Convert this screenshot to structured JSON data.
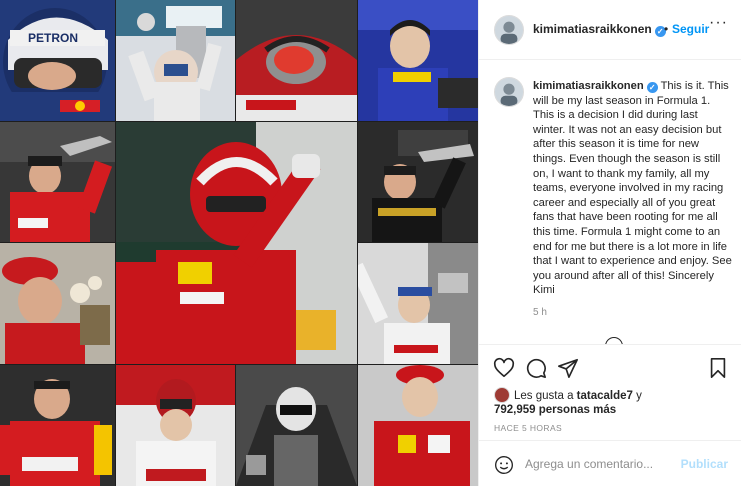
{
  "post": {
    "username": "kimimatiasraikkonen",
    "verified_glyph": "✓",
    "separator": "•",
    "follow_label": "Seguir",
    "more_glyph": "···",
    "caption": "This is it. This will be my last season in Formula 1. This is a decision I did during last winter. It was not an easy decision but after this season it is time for new things. Even though the season is still on, I want to thank my family, all my teams, everyone involved in my racing career and especially all of you great fans that have been rooting for me all this time. Formula 1 might come to an end for me but there is a lot more in life that I want to experience and enjoy. See you around after all of this! Sincerely Kimi",
    "caption_time": "5 h",
    "likes_prefix": "Les gusta a ",
    "likes_user": "tatacalde7",
    "likes_connector": " y",
    "likes_count": "792,959 personas más",
    "timestamp": "HACE 5 HORAS",
    "comment_placeholder": "Agrega un comentario...",
    "publish_label": "Publicar"
  },
  "icons": {
    "like": "heart-icon",
    "comment": "comment-icon",
    "share": "paper-plane-icon",
    "save": "bookmark-icon",
    "emoji": "smiley-icon",
    "more": "more-options-icon",
    "load_more": "load-more-comments-icon"
  },
  "colors": {
    "follow": "#0095f6",
    "verified": "#3897f0",
    "publish_disabled": "#b2dffc",
    "muted_text": "#8e8e8e",
    "ferrari_red": "#c8151b"
  }
}
